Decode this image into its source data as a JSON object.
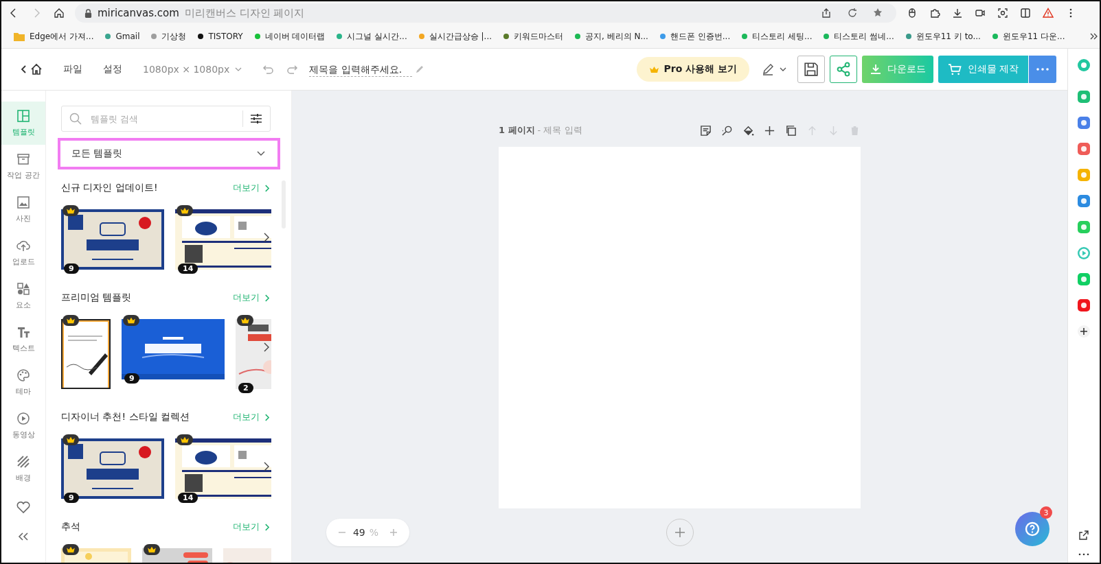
{
  "browser": {
    "domain": "miricanvas.com",
    "page_title": "미리캔버스 디자인 페이지"
  },
  "bookmarks": [
    {
      "kind": "folder",
      "label": "Edge에서 가져..."
    },
    {
      "kind": "site",
      "label": "Gmail",
      "color": "#3aa58f"
    },
    {
      "kind": "site",
      "label": "기상청",
      "color": "#9e9e9e"
    },
    {
      "kind": "site",
      "label": "TISTORY",
      "color": "#111111"
    },
    {
      "kind": "site",
      "label": "네이버 데이터랩",
      "color": "#19c13a"
    },
    {
      "kind": "site",
      "label": "시그널 실시간...",
      "color": "#2bb58a"
    },
    {
      "kind": "site",
      "label": "실시간급상승 |...",
      "color": "#f3a722"
    },
    {
      "kind": "site",
      "label": "키워드마스터",
      "color": "#5a7a2a"
    },
    {
      "kind": "site",
      "label": "공지, 베리의 N...",
      "color": "#1db954"
    },
    {
      "kind": "site",
      "label": "핸드폰 인증번...",
      "color": "#3d9be9"
    },
    {
      "kind": "site",
      "label": "티스토리 세팅...",
      "color": "#1cb95a"
    },
    {
      "kind": "site",
      "label": "티스토리 썸네...",
      "color": "#1bb85b"
    },
    {
      "kind": "site",
      "label": "윈도우11 키 to...",
      "color": "#3a9a8a"
    },
    {
      "kind": "site",
      "label": "윈도우11 다운...",
      "color": "#1ab95c"
    }
  ],
  "header": {
    "file_menu": "파일",
    "settings_menu": "설정",
    "canvas_size": "1080px × 1080px",
    "title_field": {
      "placeholder": "제목을 입력해주세요."
    },
    "pro_button": "Pro 사용해 보기",
    "download_button": "다운로드",
    "print_button": "인쇄물 제작"
  },
  "rail": [
    {
      "label": "템플릿",
      "selected": true
    },
    {
      "label": "작업 공간",
      "selected": false
    },
    {
      "label": "사진",
      "selected": false
    },
    {
      "label": "업로드",
      "selected": false
    },
    {
      "label": "요소",
      "selected": false
    },
    {
      "label": "텍스트",
      "selected": false
    },
    {
      "label": "테마",
      "selected": false
    },
    {
      "label": "동영상",
      "selected": false
    },
    {
      "label": "배경",
      "selected": false
    }
  ],
  "panel": {
    "search": {
      "placeholder": "템플릿 검색"
    },
    "category": {
      "value": "모든 템플릿",
      "highlighted": true
    },
    "sections": [
      {
        "title": "신규 디자인 업데이트!",
        "more": "더보기",
        "thumbs": [
          {
            "premium": true,
            "count": "9"
          },
          {
            "premium": true,
            "count": "14"
          }
        ]
      },
      {
        "title": "프리미엄 템플릿",
        "more": "더보기",
        "thumbs": [
          {
            "premium": true
          },
          {
            "premium": true,
            "count": "9"
          },
          {
            "premium": true,
            "count": "2"
          }
        ]
      },
      {
        "title": "디자이너 추천! 스타일 컬렉션",
        "more": "더보기",
        "thumbs": [
          {
            "premium": true,
            "count": "9"
          },
          {
            "premium": true,
            "count": "14"
          }
        ]
      },
      {
        "title": "추석",
        "more": "더보기",
        "thumbs": [
          {
            "premium": true
          },
          {
            "premium": true
          },
          {
            "premium": false
          }
        ]
      }
    ]
  },
  "canvas": {
    "page_number": "1 페이지",
    "page_title": "- 제목 입력",
    "page_tools": [
      {
        "disabled": false
      },
      {
        "disabled": false
      },
      {
        "disabled": false
      },
      {
        "disabled": false
      },
      {
        "disabled": false
      },
      {
        "disabled": true
      },
      {
        "disabled": true
      },
      {
        "disabled": true
      }
    ],
    "zoom": {
      "value": "49",
      "unit": "%"
    },
    "help_badge": "3"
  },
  "edge_sidebar": {
    "apps": [
      {
        "color": "#22c7a0"
      },
      {
        "color": "#1fbf76"
      },
      {
        "color": "#4a80e8"
      },
      {
        "color": "#ef5c58"
      },
      {
        "color": "#f5b301"
      },
      {
        "color": "#2c8be0"
      },
      {
        "color": "#27cf5c"
      },
      {
        "color": "#36c9b4"
      },
      {
        "color": "#10cf63"
      },
      {
        "color": "#f0161d"
      }
    ]
  }
}
